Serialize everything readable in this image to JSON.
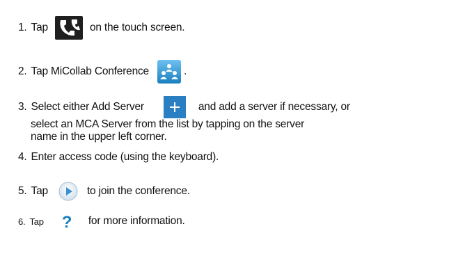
{
  "steps": [
    {
      "number": "1.",
      "before": "Tap",
      "icon": "phone-handset-icon",
      "after": "on the touch screen."
    },
    {
      "number": "2.",
      "before": "Tap MiCollab Conference",
      "icon": "conference-participants-icon",
      "after": "."
    },
    {
      "number": "3.",
      "before": "Select either Add Server",
      "icon": "add-plus-icon",
      "after": "and add a server if necessary, or",
      "line2": "select an MCA Server from the list by tapping on the server",
      "line3": "name in the upper left corner."
    },
    {
      "number": "4.",
      "text": "Enter access code (using the keyboard)."
    },
    {
      "number": "5.",
      "before": "Tap",
      "icon": "play-join-icon",
      "after": "to join the conference."
    },
    {
      "number": "6.",
      "before": "Tap",
      "icon": "help-question-icon",
      "after": "for more information."
    }
  ],
  "colors": {
    "text": "#111111",
    "icon_blue": "#1a7fc0",
    "icon_dark": "#1f1f1f",
    "plus_blue": "#2a7fc2",
    "play_blue": "#3d8fd0"
  }
}
